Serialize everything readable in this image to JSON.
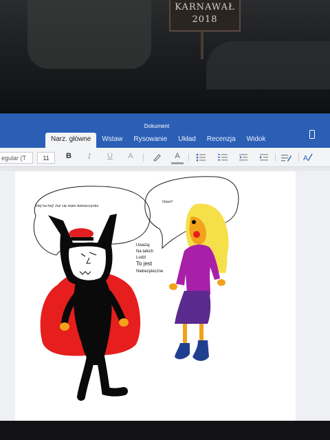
{
  "background": {
    "sign_line1": "KARNAWAŁ",
    "sign_line2": "2018"
  },
  "app": {
    "document_title": "Dokument",
    "tabs": [
      "Narz. główne",
      "Wstaw",
      "Rysowanie",
      "Układ",
      "Recenzja",
      "Widok"
    ],
    "active_tab": "Narz. główne"
  },
  "ribbon": {
    "font_name": "egular (T",
    "font_size": "11",
    "bold_label": "B",
    "italic_label": "I",
    "underline_label": "U",
    "font_color_label": "A",
    "highlight_label": "A"
  },
  "drawing": {
    "bubble_left_text": "Hej ha hej! Już cię mam dziewczynko",
    "bubble_right_text": "Oww!!",
    "note_lines": [
      "Uważaj",
      "Na takich",
      "Ludzi",
      "To jest",
      "Niebezpieczne"
    ],
    "colors": {
      "cape": "#e61e1e",
      "body": "#0a0a0a",
      "face": "#ffffff",
      "hat": "#e02020",
      "hair": "#f6e04a",
      "girl_face": "#f2a21b",
      "shirt": "#a81fa8",
      "skirt": "#5b2a8e",
      "boots": "#1f3f8f"
    }
  }
}
